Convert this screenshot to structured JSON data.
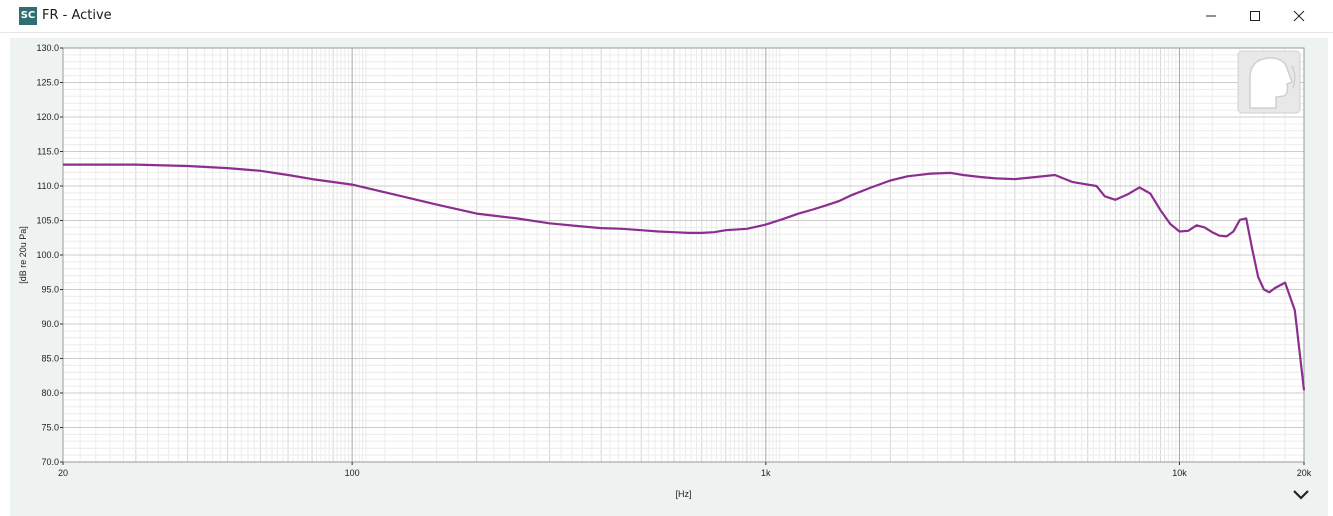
{
  "window": {
    "icon_text": "SC",
    "title": "FR - Active",
    "buttons": [
      "minimize-icon",
      "maximize-icon",
      "close-icon"
    ]
  },
  "colors": {
    "curve": "#8b2f8f",
    "grid_major": "#b5b5b5",
    "grid_minor": "#e2e2e2",
    "background": "#ffffff"
  },
  "chart_data": {
    "type": "line",
    "title": "",
    "xlabel": "[Hz]",
    "ylabel": "[dB re 20u Pa]",
    "xscale": "log",
    "xlim": [
      20,
      20000
    ],
    "ylim": [
      70,
      130
    ],
    "x_ticks": [
      20,
      100,
      1000,
      10000,
      20000
    ],
    "x_tick_labels": [
      "20",
      "100",
      "1k",
      "10k",
      "20k"
    ],
    "y_ticks": [
      70,
      75,
      80,
      85,
      90,
      95,
      100,
      105,
      110,
      115,
      120,
      125,
      130
    ],
    "y_tick_labels": [
      "70.0",
      "75.0",
      "80.0",
      "85.0",
      "90.0",
      "95.0",
      "100.0",
      "105.0",
      "110.0",
      "115.0",
      "120.0",
      "125.0",
      "130.0"
    ],
    "grid": true,
    "series": [
      {
        "x": [
          20,
          30,
          40,
          50,
          60,
          70,
          80,
          100,
          130,
          160,
          200,
          250,
          300,
          350,
          400,
          450,
          500,
          550,
          600,
          650,
          700,
          750,
          800,
          900,
          1000,
          1100,
          1200,
          1300,
          1400,
          1500,
          1600,
          1800,
          2000,
          2200,
          2500,
          2800,
          3000,
          3300,
          3600,
          4000,
          4500,
          5000,
          5500,
          6000,
          6300,
          6600,
          7000,
          7500,
          8000,
          8500,
          9000,
          9500,
          10000,
          10500,
          11000,
          11500,
          12000,
          12500,
          13000,
          13500,
          14000,
          14500,
          15000,
          15500,
          16000,
          16500,
          17000,
          18000,
          19000,
          20000
        ],
        "y": [
          113.1,
          113.1,
          112.9,
          112.6,
          112.2,
          111.6,
          111.0,
          110.2,
          108.6,
          107.3,
          106.0,
          105.3,
          104.6,
          104.2,
          103.9,
          103.8,
          103.6,
          103.4,
          103.3,
          103.2,
          103.2,
          103.3,
          103.6,
          103.8,
          104.4,
          105.2,
          106.0,
          106.6,
          107.2,
          107.8,
          108.6,
          109.8,
          110.8,
          111.4,
          111.8,
          111.9,
          111.6,
          111.3,
          111.1,
          111.0,
          111.3,
          111.6,
          110.6,
          110.2,
          110.0,
          108.5,
          108.0,
          108.8,
          109.8,
          108.9,
          106.5,
          104.5,
          103.4,
          103.5,
          104.3,
          104.0,
          103.3,
          102.8,
          102.7,
          103.4,
          105.1,
          105.3,
          100.8,
          96.8,
          95.0,
          94.6,
          95.2,
          96.0,
          92.0,
          80.4
        ]
      }
    ]
  }
}
